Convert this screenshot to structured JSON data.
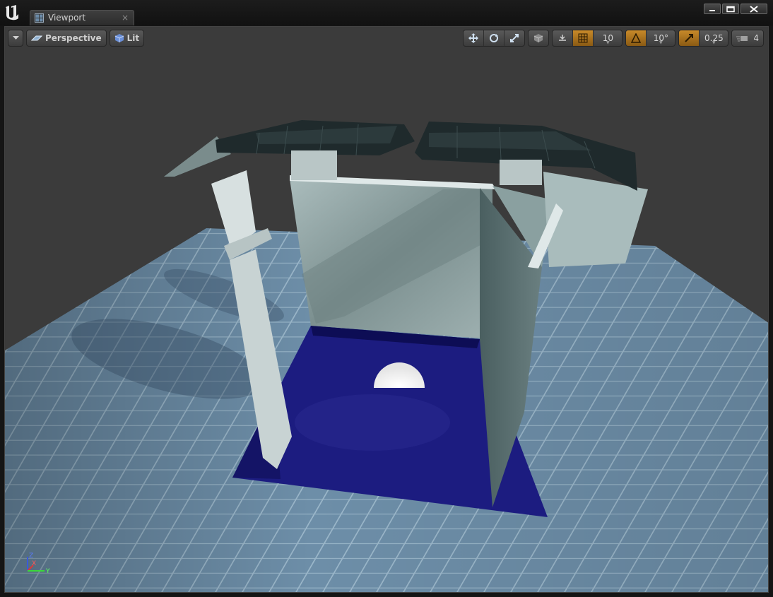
{
  "window": {
    "tab_label": "Viewport",
    "tab_close": "×",
    "logo_icon": "unreal-logo-icon"
  },
  "toolbar": {
    "menu_icon": "chevron-down-icon",
    "view_mode_label": "Perspective",
    "lighting_label": "Lit",
    "grid_snap_value": "10",
    "rotation_snap_value": "10°",
    "scale_snap_value": "0.25",
    "camera_speed_value": "4"
  },
  "colors": {
    "accent_active": "#c88a2a",
    "water": "#1a1a7a",
    "floor": "#6c8fa8",
    "background": "#3b3b3b"
  },
  "gizmo": {
    "z_label": "Z",
    "x_label": "X",
    "y_label": "Y"
  }
}
